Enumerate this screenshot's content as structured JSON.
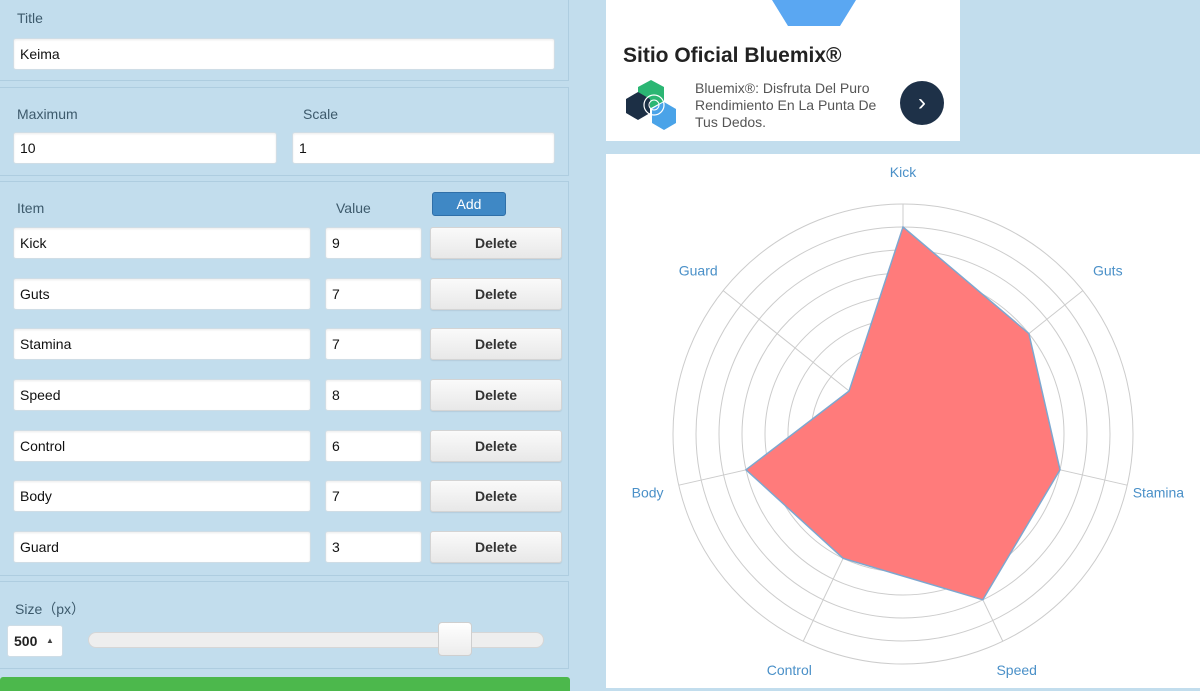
{
  "form": {
    "title_label": "Title",
    "title_value": "Keima",
    "maximum_label": "Maximum",
    "maximum_value": "10",
    "scale_label": "Scale",
    "scale_value": "1",
    "item_header": "Item",
    "value_header": "Value",
    "add_label": "Add",
    "delete_label": "Delete",
    "items": [
      {
        "name": "Kick",
        "value": "9"
      },
      {
        "name": "Guts",
        "value": "7"
      },
      {
        "name": "Stamina",
        "value": "7"
      },
      {
        "name": "Speed",
        "value": "8"
      },
      {
        "name": "Control",
        "value": "6"
      },
      {
        "name": "Body",
        "value": "7"
      },
      {
        "name": "Guard",
        "value": "3"
      }
    ],
    "size_label": "Size（px）",
    "size_value": "500",
    "size_slider_fraction": 0.83
  },
  "ad": {
    "title": "Sitio Oficial Bluemix®",
    "text": "Bluemix®: Disfruta Del Puro Rendimiento En La Punta De Tus Dedos.",
    "arrow_icon": "chevron-right-icon"
  },
  "chart_data": {
    "type": "radar",
    "categories": [
      "Kick",
      "Guts",
      "Stamina",
      "Speed",
      "Control",
      "Body",
      "Guard"
    ],
    "series": [
      {
        "values": [
          9,
          7,
          7,
          8,
          6,
          7,
          3
        ]
      }
    ],
    "max": 10,
    "rings": 10,
    "fill_color": "#ff7b7b",
    "line_color": "#7ea7cf",
    "label_color": "#4a90c8",
    "grid_color": "#cccccc"
  }
}
